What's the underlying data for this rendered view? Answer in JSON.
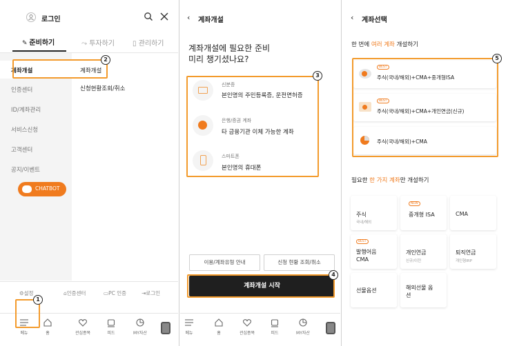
{
  "menu_panel": {
    "login_label": "로그인",
    "tabs": [
      {
        "label": "준비하기",
        "icon": "pencil-icon"
      },
      {
        "label": "투자하기",
        "icon": "trend-icon"
      },
      {
        "label": "관리하기",
        "icon": "document-icon"
      }
    ],
    "sidebar": [
      "계좌개설",
      "인증센터",
      "ID/계좌관리",
      "서비스신청",
      "고객센터",
      "공지/이벤트"
    ],
    "chatbot_label": "CHATBOT",
    "submenu": [
      "계좌개설",
      "신청현황조회/취소"
    ],
    "footer_links": [
      "설정",
      "인증센터",
      "PC 인증",
      "로그인"
    ]
  },
  "bottom_nav": [
    "메뉴",
    "홈",
    "관심종목",
    "피드",
    "MY자산"
  ],
  "open_panel": {
    "title": "계좌개설",
    "heading_line1": "계좌개설에 필요한 준비",
    "heading_line2": "미리 챙기셨나요?",
    "items": [
      {
        "caption": "신분증",
        "text": "본인명의 주민등록증, 운전면허증",
        "icon": "id-card-icon"
      },
      {
        "caption": "은행/증권 계좌",
        "text": "타 금융기관 이체 가능한 계좌",
        "icon": "coin-icon"
      },
      {
        "caption": "스마트폰",
        "text": "본인명의 휴대폰",
        "icon": "smartphone-icon"
      }
    ],
    "btn_guide": "이용/계좌유형 안내",
    "btn_status": "신청 현황 조회/취소",
    "btn_start": "계좌개설 시작"
  },
  "select_panel": {
    "title": "계좌선택",
    "section1_pre": "한 번에 ",
    "section1_hl": "여러 계좌",
    "section1_post": " 개설하기",
    "multi_items": [
      {
        "badge": "BEST",
        "label": "주식(국내/해외)+CMA+중개형ISA"
      },
      {
        "badge": "BEST",
        "label": "주식(국내/해외)+CMA+개인연금(신규)"
      },
      {
        "badge": "",
        "label": "주식(국내/해외)+CMA"
      }
    ],
    "section2_pre": "필요한 ",
    "section2_hl": "한 가지 계좌",
    "section2_post": "만 개설하기",
    "single_tiles": [
      {
        "badge": "",
        "title": "주식",
        "sub": "국내/해외"
      },
      {
        "badge": "NEW",
        "title": "중개형 ISA",
        "sub": ""
      },
      {
        "badge": "",
        "title": "CMA",
        "sub": ""
      },
      {
        "badge": "BEST",
        "title": "발행어음 CMA",
        "sub": ""
      },
      {
        "badge": "",
        "title": "개인연금",
        "sub": "신규/이전"
      },
      {
        "badge": "",
        "title": "퇴직연금",
        "sub": "개인형IRP"
      },
      {
        "badge": "",
        "title": "선물옵션",
        "sub": ""
      },
      {
        "badge": "",
        "title": "해외선물 옵션",
        "sub": ""
      }
    ]
  },
  "annotations": [
    "1",
    "2",
    "3",
    "4",
    "5"
  ],
  "colors": {
    "accent": "#f07b1e",
    "annotation": "#f39a2b",
    "start_button": "#1f1f1f"
  }
}
